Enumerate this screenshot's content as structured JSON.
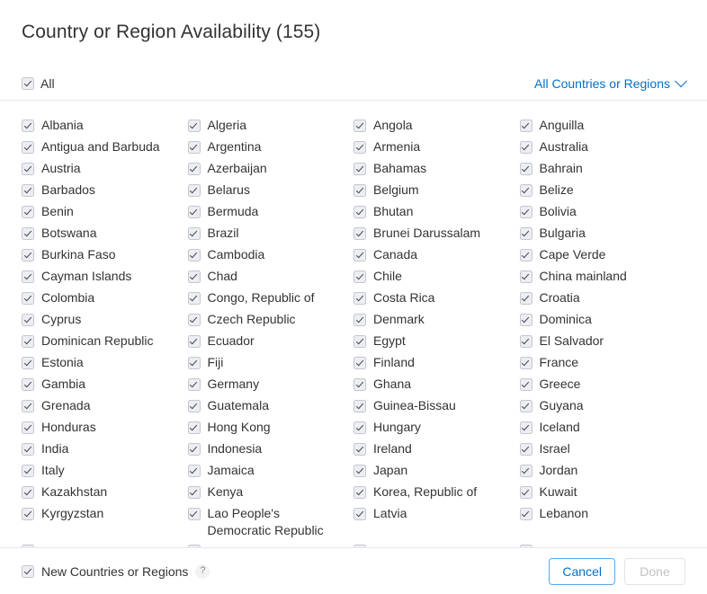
{
  "dialog": {
    "title": "Country or Region Availability (155)",
    "count": 155
  },
  "subheader": {
    "all_label": "All",
    "all_checked": true,
    "region_filter_label": "All Countries or Regions",
    "chevron_icon": "chevron-down-icon"
  },
  "colors": {
    "accent": "#0070c9",
    "text": "#333336",
    "divider": "#e8e8ed",
    "checkbox_fill": "#eceef2",
    "checkbox_border": "#c3c7d0",
    "check_mark": "#3d4148",
    "disabled_text": "#c2c2c6"
  },
  "columns": [
    {
      "items": [
        "Albania",
        "Antigua and Barbuda",
        "Austria",
        "Barbados",
        "Benin",
        "Botswana",
        "Burkina Faso",
        "Cayman Islands",
        "Colombia",
        "Cyprus",
        "Dominican Republic",
        "Estonia",
        "Gambia",
        "Grenada",
        "Honduras",
        "India",
        "Italy",
        "Kazakhstan",
        "Kyrgyzstan"
      ]
    },
    {
      "items": [
        "Algeria",
        "Argentina",
        "Azerbaijan",
        "Belarus",
        "Bermuda",
        "Brazil",
        "Cambodia",
        "Chad",
        "Congo, Republic of",
        "Czech Republic",
        "Ecuador",
        "Fiji",
        "Germany",
        "Guatemala",
        "Hong Kong",
        "Indonesia",
        "Jamaica",
        "Kenya",
        "Lao People's Democratic Republic"
      ]
    },
    {
      "items": [
        "Angola",
        "Armenia",
        "Bahamas",
        "Belgium",
        "Bhutan",
        "Brunei Darussalam",
        "Canada",
        "Chile",
        "Costa Rica",
        "Denmark",
        "Egypt",
        "Finland",
        "Ghana",
        "Guinea-Bissau",
        "Hungary",
        "Ireland",
        "Japan",
        "Korea, Republic of",
        "Latvia"
      ]
    },
    {
      "items": [
        "Anguilla",
        "Australia",
        "Bahrain",
        "Belize",
        "Bolivia",
        "Bulgaria",
        "Cape Verde",
        "China mainland",
        "Croatia",
        "Dominica",
        "El Salvador",
        "France",
        "Greece",
        "Guyana",
        "Iceland",
        "Israel",
        "Jordan",
        "Kuwait",
        "Lebanon"
      ]
    }
  ],
  "footer": {
    "new_regions_label": "New Countries or Regions",
    "new_regions_checked": true,
    "help_glyph": "?",
    "cancel_label": "Cancel",
    "done_label": "Done",
    "done_disabled": true
  }
}
